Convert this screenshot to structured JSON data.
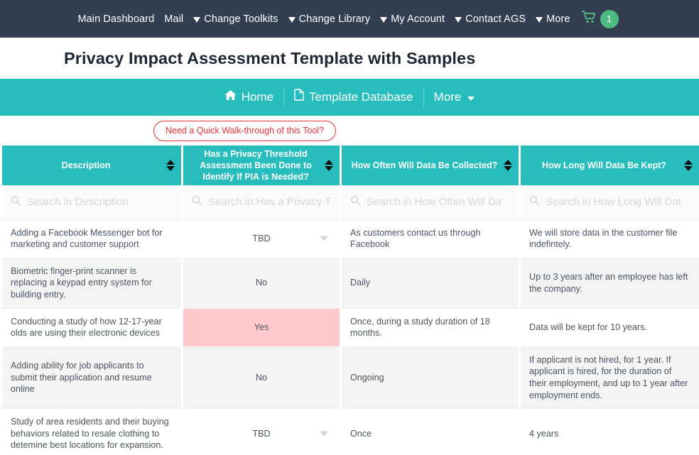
{
  "topnav": {
    "items": [
      {
        "label": "Main Dashboard",
        "caret": false
      },
      {
        "label": "Mail",
        "caret": false
      },
      {
        "label": "Change Toolkits",
        "caret": true
      },
      {
        "label": "Change Library",
        "caret": true
      },
      {
        "label": "My Account",
        "caret": true
      },
      {
        "label": "Contact AGS",
        "caret": true
      },
      {
        "label": "More",
        "caret": true
      }
    ],
    "cart_icon": "shopping-cart-icon",
    "cart_count": "1",
    "cart_badge_color": "#4cbb7f",
    "background_color": "#333f50"
  },
  "header": {
    "title": "Privacy Impact Assessment Template with Samples"
  },
  "subnav": {
    "accent_color": "#26bdbc",
    "items": [
      {
        "label": "Home",
        "icon": "home-icon",
        "caret": false
      },
      {
        "label": "Template Database",
        "icon": "file-document-icon",
        "caret": false
      },
      {
        "label": "More",
        "icon": "",
        "caret": true
      }
    ]
  },
  "walkthrough": {
    "label": "Need a Quick Walk-through of this Tool?",
    "color": "#e8313a"
  },
  "table": {
    "columns": [
      {
        "label": "Description",
        "search_placeholder": "Search in Description"
      },
      {
        "label": "Has a Privacy Threshold Assessment Been Done to Identify If PIA is Needed?",
        "search_placeholder": "Search in Has a Privacy T"
      },
      {
        "label": "How Often Will Data Be Collected?",
        "search_placeholder": "Search in How Often Will Da"
      },
      {
        "label": "How Long Will Data Be Kept?",
        "search_placeholder": "Search in How Long Will Dat"
      }
    ],
    "flag_color": "#ffc9ce",
    "rows": [
      {
        "description": "Adding a Facebook Messenger bot for marketing and customer support",
        "pta_status": "TBD",
        "has_caret": true,
        "flagged": false,
        "frequency": "As customers contact us through Facebook",
        "retention": "We will store data in the customer file indefintely."
      },
      {
        "description": "Biometric finger-print scanner is replacing a keypad entry system for building entry.",
        "pta_status": "No",
        "has_caret": false,
        "flagged": false,
        "frequency": "Daily",
        "retention": "Up to 3 years after an employee has left the company."
      },
      {
        "description": "Conducting a study of how 12-17-year olds are using their electronic devices",
        "pta_status": "Yes",
        "has_caret": false,
        "flagged": true,
        "frequency": "Once, during a study duration of 18 months.",
        "retention": "Data will be kept for 10 years."
      },
      {
        "description": "Adding ability for job applicants to submit their application and resume online",
        "pta_status": "No",
        "has_caret": false,
        "flagged": false,
        "frequency": "Ongoing",
        "retention": "If applicant is not hired, for 1 year. If applicant is hired, for the duration of their employment, and up to 1 year after employment ends."
      },
      {
        "description": "Study of area residents and their buying behaviors related to resale clothing to detemine best locations for expansion.",
        "pta_status": "TBD",
        "has_caret": true,
        "flagged": false,
        "frequency": "Once",
        "retention": "4 years"
      }
    ]
  }
}
